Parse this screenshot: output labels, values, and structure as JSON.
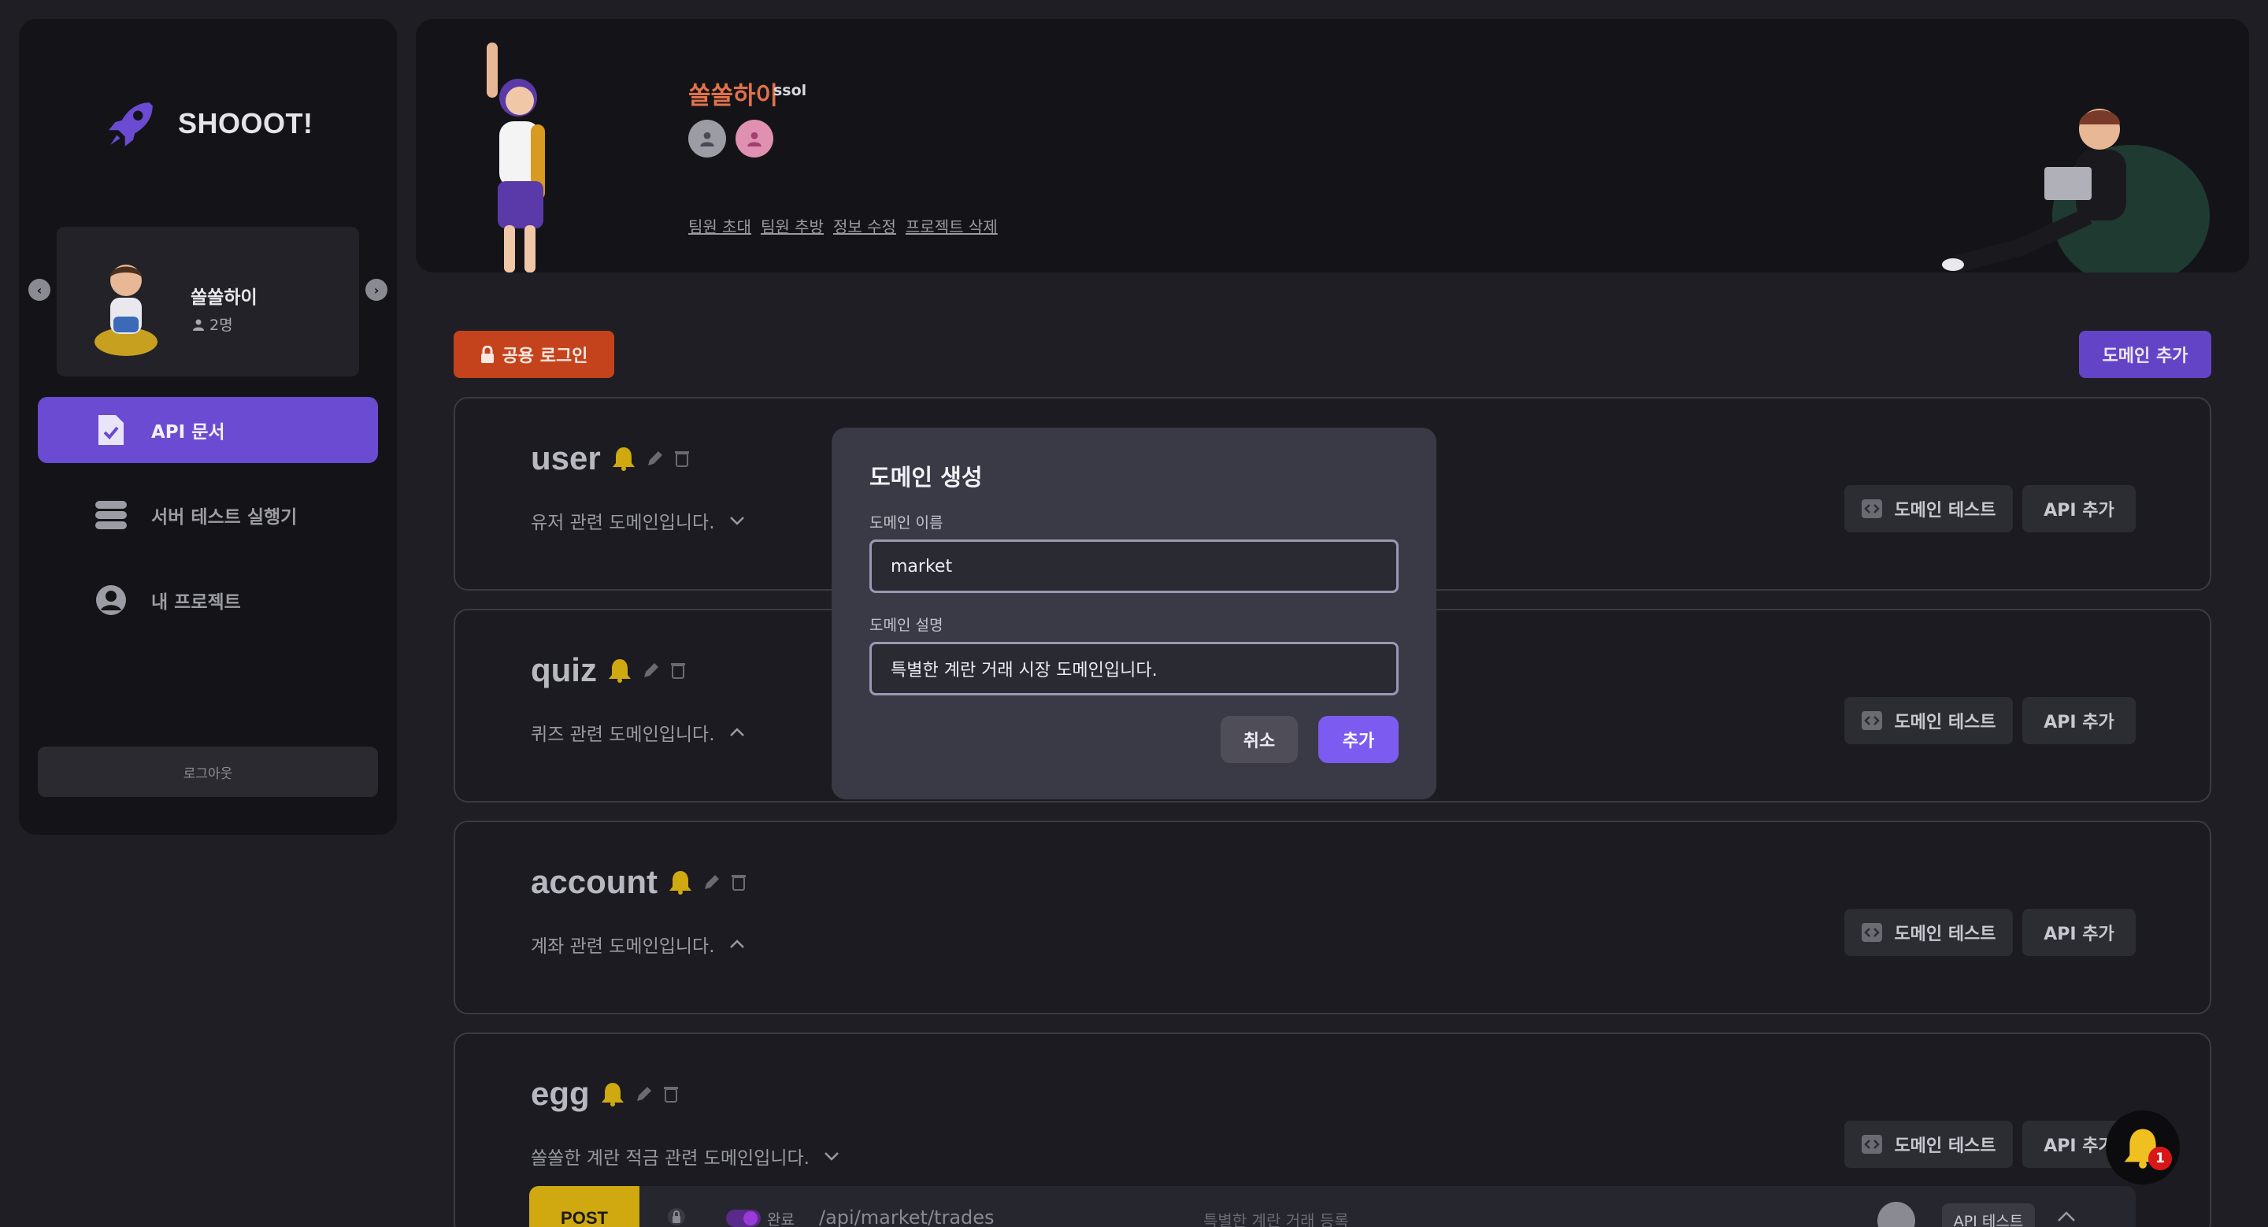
{
  "app": {
    "logo_text": "SHOOOT!",
    "logout_label": "로그아웃"
  },
  "team": {
    "name": "쏠쏠하이",
    "member_count": "2명"
  },
  "nav": {
    "items": [
      {
        "label": "API 문서",
        "icon": "document-check-icon",
        "active": true
      },
      {
        "label": "서버 테스트 실행기",
        "icon": "server-icon",
        "active": false
      },
      {
        "label": "내 프로젝트",
        "icon": "user-circle-icon",
        "active": false
      }
    ]
  },
  "project": {
    "name": "쏠쏠하이",
    "subname": "ssol",
    "links": [
      "팀원 초대",
      "팀원 추방",
      "정보 수정",
      "프로젝트 삭제"
    ]
  },
  "toolbar": {
    "shared_login_label": "공용 로그인",
    "add_domain_label": "도메인 추가"
  },
  "domains": [
    {
      "name": "user",
      "description": "유저 관련 도메인입니다.",
      "expanded": false
    },
    {
      "name": "quiz",
      "description": "퀴즈 관련 도메인입니다.",
      "expanded": true
    },
    {
      "name": "account",
      "description": "계좌 관련 도메인입니다.",
      "expanded": true
    },
    {
      "name": "egg",
      "description": "쏠쏠한 계란 적금 관련 도메인입니다.",
      "expanded": false
    }
  ],
  "domain_buttons": {
    "test_label": "도메인 테스트",
    "add_api_label": "API 추가"
  },
  "api_row": {
    "method": "POST",
    "status": "완료",
    "path": "/api/market/trades",
    "description": "특별한 계란 거래 등록",
    "test_label": "API 테스트"
  },
  "modal": {
    "title": "도메인 생성",
    "name_label": "도메인 이름",
    "name_value": "market",
    "desc_label": "도메인 설명",
    "desc_value": "특별한 계란 거래 시장 도메인입니다.",
    "cancel_label": "취소",
    "submit_label": "추가"
  },
  "notifications": {
    "count": "1"
  },
  "colors": {
    "accent": "#6a4bd2",
    "login_button": "#c4431c",
    "post_badge": "#d0a810",
    "bell": "#d0a810",
    "modal_submit": "#7c5cf0"
  }
}
